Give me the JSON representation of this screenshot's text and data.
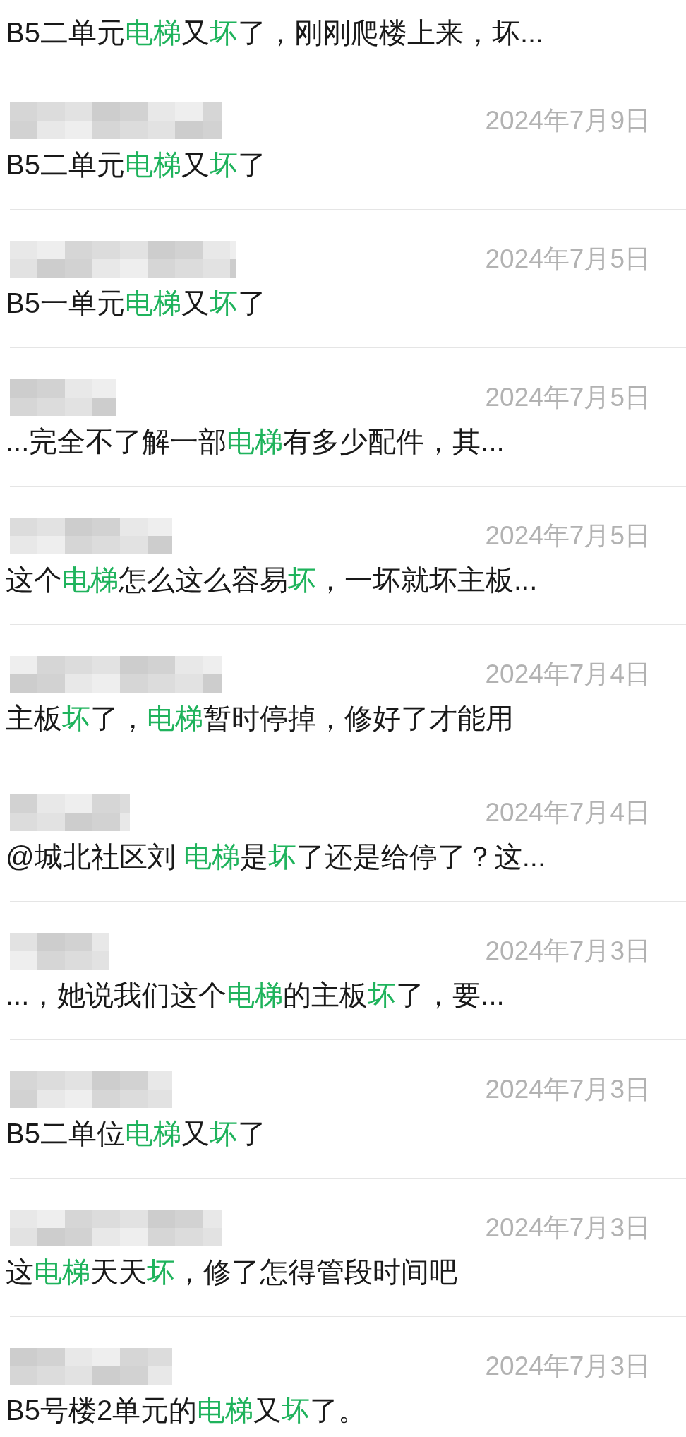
{
  "results": [
    {
      "message": [
        {
          "text": "B5二单元",
          "highlight": false
        },
        {
          "text": "电梯",
          "highlight": true
        },
        {
          "text": "又",
          "highlight": false
        },
        {
          "text": "坏",
          "highlight": true
        },
        {
          "text": "了，刚刚爬楼上来，坏...",
          "highlight": false
        }
      ]
    },
    {
      "date": "2024年7月9日",
      "message": [
        {
          "text": "B5二单元",
          "highlight": false
        },
        {
          "text": "电梯",
          "highlight": true
        },
        {
          "text": "又",
          "highlight": false
        },
        {
          "text": "坏",
          "highlight": true
        },
        {
          "text": "了",
          "highlight": false
        }
      ]
    },
    {
      "date": "2024年7月5日",
      "message": [
        {
          "text": "B5一单元",
          "highlight": false
        },
        {
          "text": "电梯",
          "highlight": true
        },
        {
          "text": "又",
          "highlight": false
        },
        {
          "text": "坏",
          "highlight": true
        },
        {
          "text": "了",
          "highlight": false
        }
      ]
    },
    {
      "date": "2024年7月5日",
      "message": [
        {
          "text": "...完全不了解一部",
          "highlight": false
        },
        {
          "text": "电梯",
          "highlight": true
        },
        {
          "text": "有多少配件，其...",
          "highlight": false
        }
      ]
    },
    {
      "date": "2024年7月5日",
      "message": [
        {
          "text": "这个",
          "highlight": false
        },
        {
          "text": "电梯",
          "highlight": true
        },
        {
          "text": "怎么这么容易",
          "highlight": false
        },
        {
          "text": "坏",
          "highlight": true
        },
        {
          "text": "，一坏就坏主板...",
          "highlight": false
        }
      ]
    },
    {
      "date": "2024年7月4日",
      "message": [
        {
          "text": "主板",
          "highlight": false
        },
        {
          "text": "坏",
          "highlight": true
        },
        {
          "text": "了，",
          "highlight": false
        },
        {
          "text": "电梯",
          "highlight": true
        },
        {
          "text": "暂时停掉，修好了才能用",
          "highlight": false
        }
      ]
    },
    {
      "date": "2024年7月4日",
      "message": [
        {
          "text": "@城北社区刘 ",
          "highlight": false
        },
        {
          "text": "电梯",
          "highlight": true
        },
        {
          "text": "是",
          "highlight": false
        },
        {
          "text": "坏",
          "highlight": true
        },
        {
          "text": "了还是给停了？这...",
          "highlight": false
        }
      ]
    },
    {
      "date": "2024年7月3日",
      "message": [
        {
          "text": "...，她说我们这个",
          "highlight": false
        },
        {
          "text": "电梯",
          "highlight": true
        },
        {
          "text": "的主板",
          "highlight": false
        },
        {
          "text": "坏",
          "highlight": true
        },
        {
          "text": "了，要...",
          "highlight": false
        }
      ]
    },
    {
      "date": "2024年7月3日",
      "message": [
        {
          "text": "B5二单位",
          "highlight": false
        },
        {
          "text": "电梯",
          "highlight": true
        },
        {
          "text": "又",
          "highlight": false
        },
        {
          "text": "坏",
          "highlight": true
        },
        {
          "text": "了",
          "highlight": false
        }
      ]
    },
    {
      "date": "2024年7月3日",
      "message": [
        {
          "text": "这",
          "highlight": false
        },
        {
          "text": "电梯",
          "highlight": true
        },
        {
          "text": "天天",
          "highlight": false
        },
        {
          "text": "坏",
          "highlight": true
        },
        {
          "text": "，修了怎得管段时间吧",
          "highlight": false
        }
      ]
    },
    {
      "date": "2024年7月3日",
      "message": [
        {
          "text": "B5号楼2单元的",
          "highlight": false
        },
        {
          "text": "电梯",
          "highlight": true
        },
        {
          "text": "又",
          "highlight": false
        },
        {
          "text": "坏",
          "highlight": true
        },
        {
          "text": "了。",
          "highlight": false
        }
      ]
    }
  ]
}
